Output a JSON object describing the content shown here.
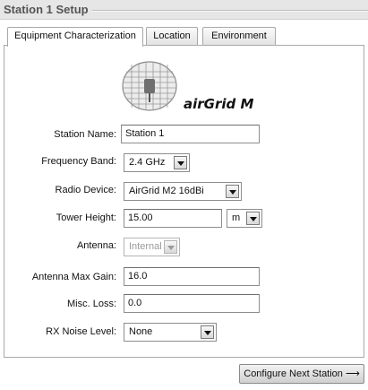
{
  "header": {
    "title": "Station 1 Setup"
  },
  "tabs": [
    {
      "label": "Equipment Characterization",
      "active": true
    },
    {
      "label": "Location",
      "active": false
    },
    {
      "label": "Environment",
      "active": false
    }
  ],
  "logo": {
    "icon": "airgrid-antenna-icon",
    "text": "airGrid M"
  },
  "form": {
    "station_name": {
      "label": "Station Name:",
      "value": "Station 1"
    },
    "frequency_band": {
      "label": "Frequency Band:",
      "value": "2.4 GHz"
    },
    "radio_device": {
      "label": "Radio Device:",
      "value": "AirGrid M2 16dBi"
    },
    "tower_height": {
      "label": "Tower Height:",
      "value": "15.00",
      "unit": "m"
    },
    "antenna": {
      "label": "Antenna:",
      "value": "Internal",
      "disabled": true
    },
    "antenna_max_gain": {
      "label": "Antenna Max Gain:",
      "value": "16.0"
    },
    "misc_loss": {
      "label": "Misc. Loss:",
      "value": "0.0"
    },
    "rx_noise_level": {
      "label": "RX Noise Level:",
      "value": "None"
    }
  },
  "footer": {
    "next_label": "Configure Next Station ⟶"
  }
}
